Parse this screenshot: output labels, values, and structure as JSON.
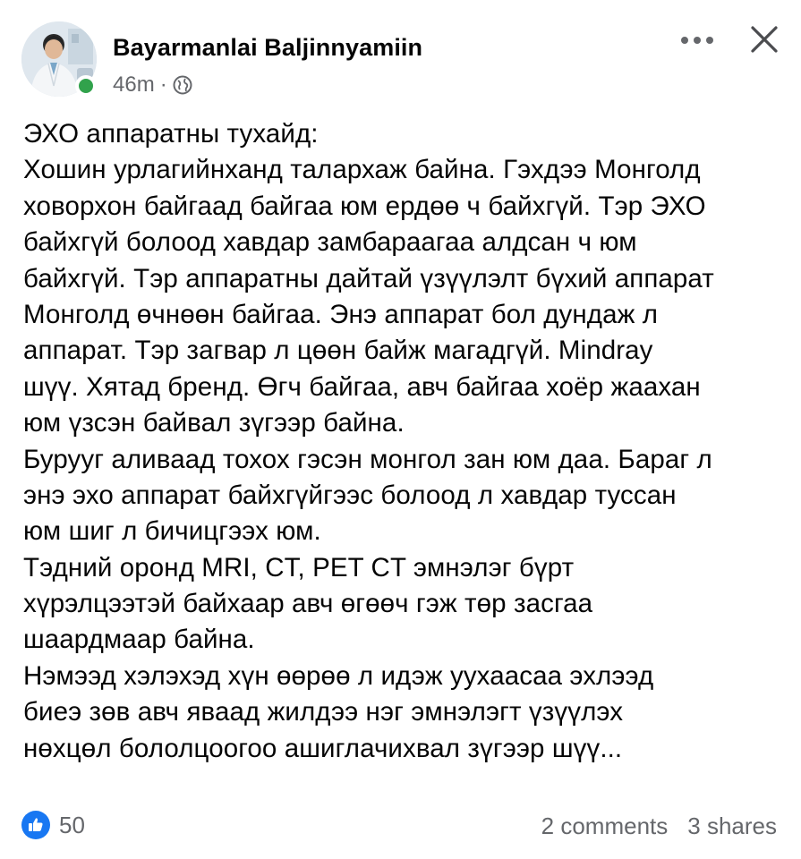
{
  "post": {
    "author": {
      "name": "Bayarmanlai Baljinnyamiin",
      "online": true
    },
    "meta": {
      "time": "46m",
      "separator": "·",
      "audience_icon": "globe-icon"
    },
    "actions": {
      "more_icon": "more-horizontal-icon",
      "close_icon": "close-icon"
    },
    "lines": [
      "ЭХО аппаратны тухайд:",
      "Хошин урлагийнханд талархаж байна. Гэхдээ Монголд",
      "ховорхон байгаад байгаа юм ердөө ч байхгүй. Тэр ЭХО",
      "байхгүй болоод хавдар замбараагаа алдсан ч юм",
      "байхгүй. Тэр аппаратны дайтай үзүүлэлт бүхий аппарат",
      "Монголд өчнөөн байгаа. Энэ аппарат бол дундаж л",
      "аппарат. Тэр загвар л цөөн байж магадгүй. Mindray",
      "шүү. Хятад бренд. Өгч байгаа, авч байгаа хоёр жаахан",
      "юм үзсэн байвал зүгээр байна.",
      "Бурууг аливаад тохох гэсэн монгол зан юм даа. Бараг л",
      "энэ эхо аппарат байхгүйгээс болоод л хавдар туссан",
      "юм шиг л бичицгээх юм.",
      "Тэдний оронд MRI, CT, PET CT эмнэлэг бүрт",
      "хүрэлцээтэй байхаар авч өгөөч гэж төр засгаа",
      "шаардмаар байна.",
      "Нэмээд хэлэхэд хүн өөрөө л идэж уухаасаа эхлээд",
      "биеэ зөв авч яваад жилдээ нэг эмнэлэгт үзүүлэх",
      "нөхцөл бололцоогоо ашиглачихвал зүгээр шүү..."
    ],
    "footer": {
      "reaction_icon": "like-icon",
      "reaction_count": "50",
      "comments": "2 comments",
      "shares": "3 shares"
    },
    "colors": {
      "text": "#050505",
      "secondary_text": "#65676b",
      "like_blue": "#1877f2",
      "online_green": "#31a24c"
    }
  }
}
